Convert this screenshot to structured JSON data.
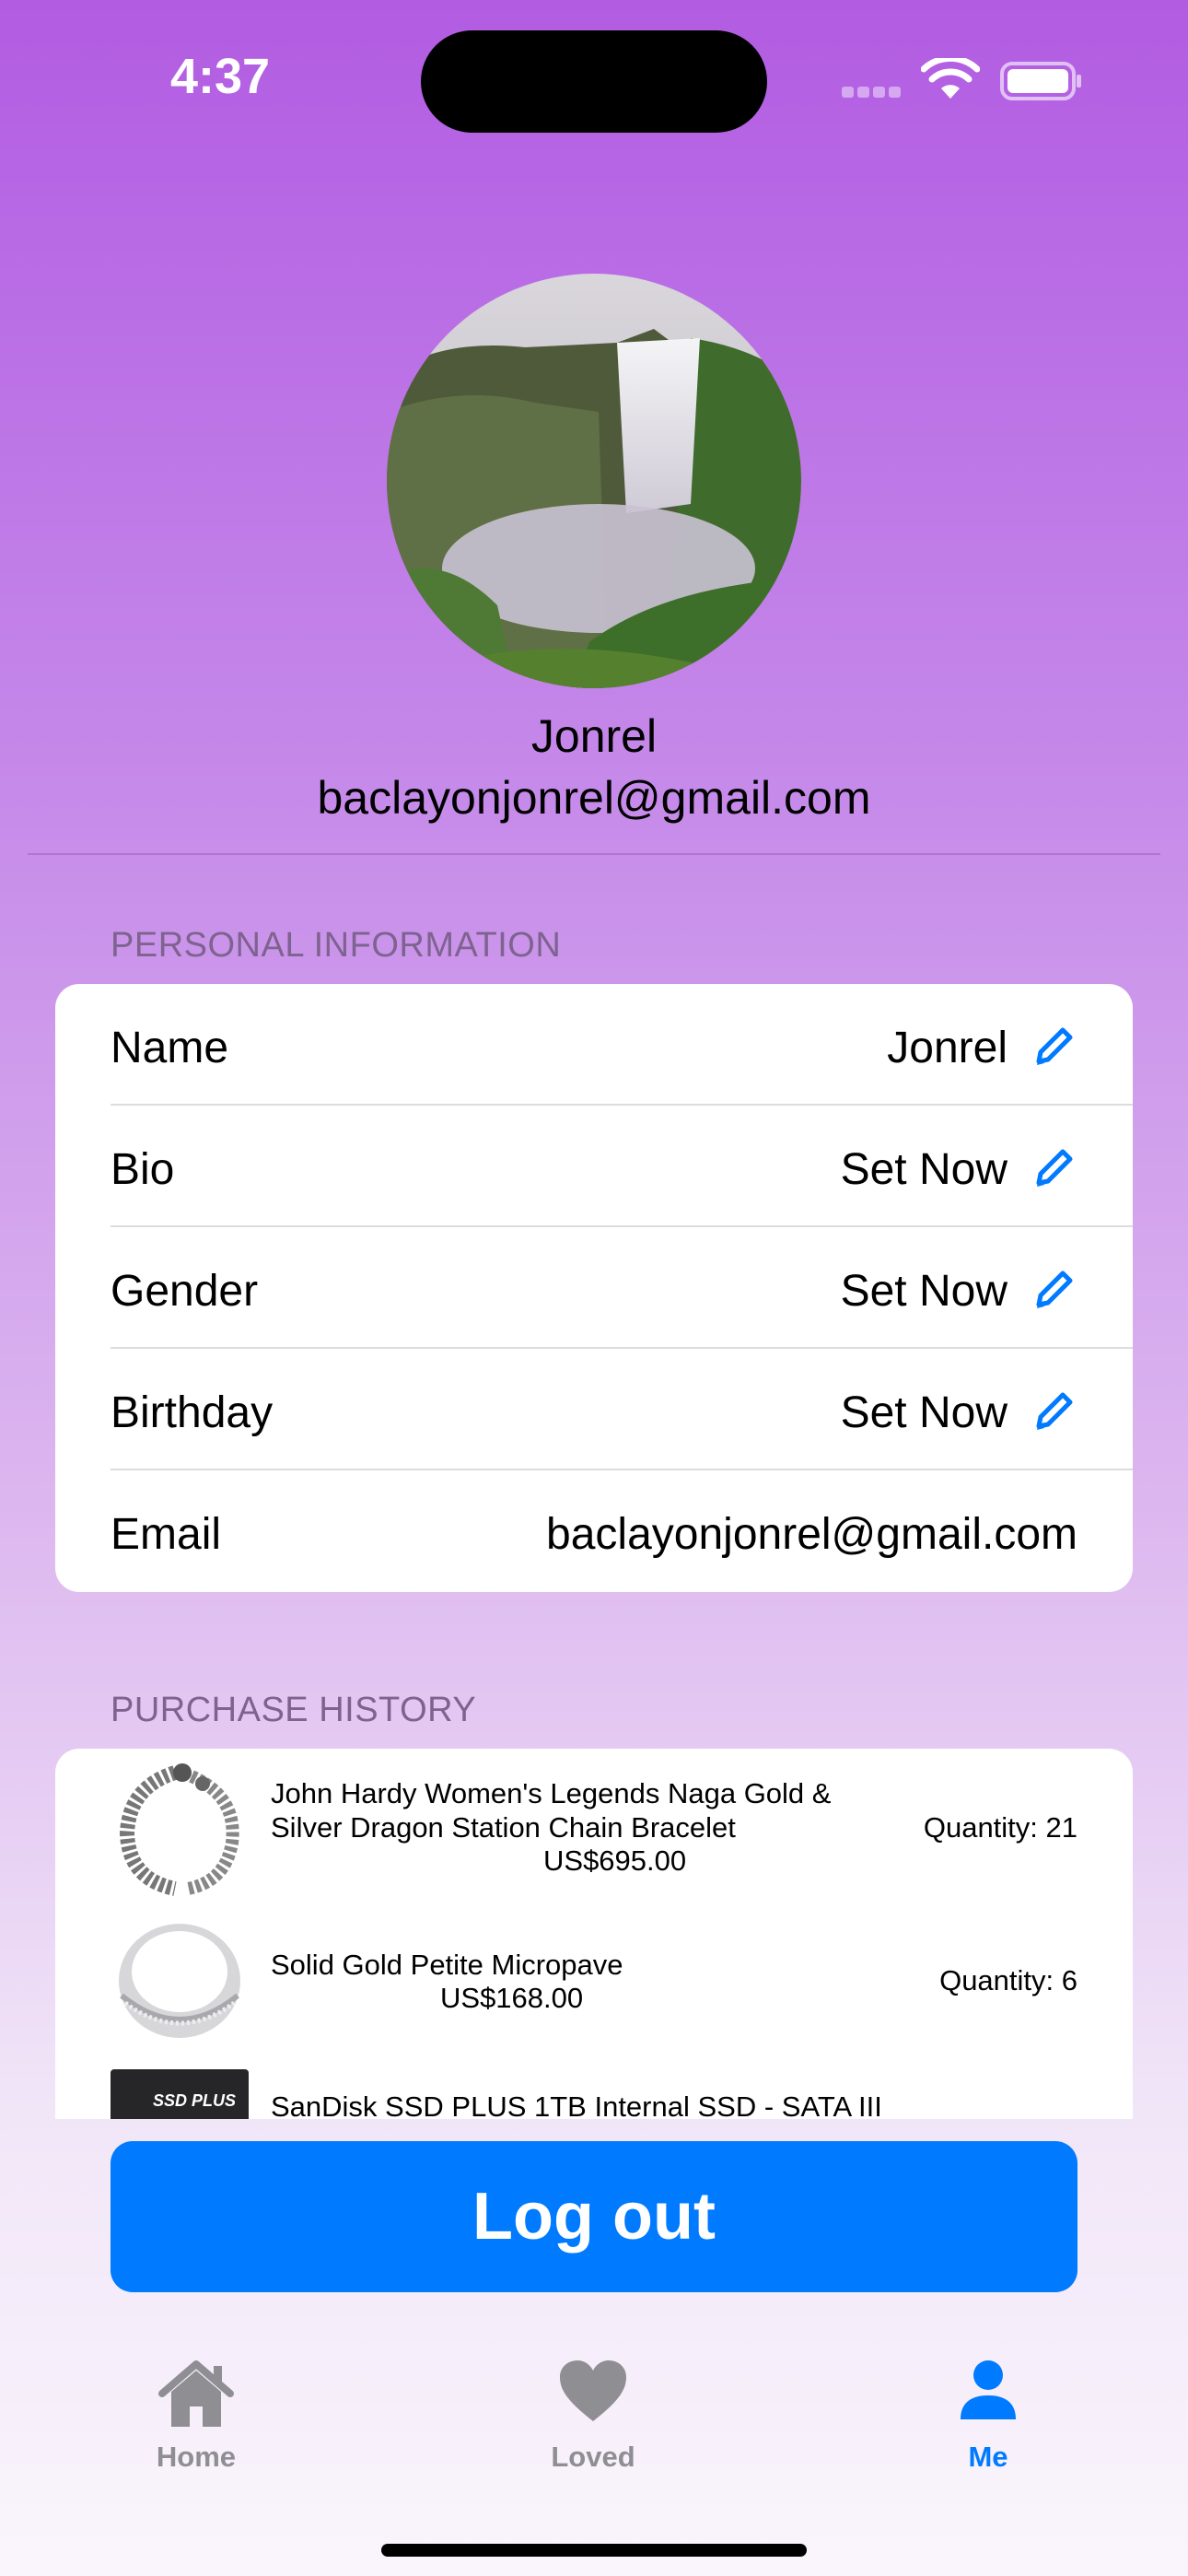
{
  "status_bar": {
    "time": "4:37"
  },
  "profile": {
    "name": "Jonrel",
    "email": "baclayonjonrel@gmail.com",
    "avatar": "waterfall-photo"
  },
  "personal_info": {
    "header": "PERSONAL INFORMATION",
    "rows": [
      {
        "label": "Name",
        "value": "Jonrel",
        "editable": true
      },
      {
        "label": "Bio",
        "value": "Set Now",
        "editable": true
      },
      {
        "label": "Gender",
        "value": "Set Now",
        "editable": true
      },
      {
        "label": "Birthday",
        "value": "Set Now",
        "editable": true
      },
      {
        "label": "Email",
        "value": "baclayonjonrel@gmail.com",
        "editable": false
      }
    ]
  },
  "purchase_history": {
    "header": "PURCHASE HISTORY",
    "items": [
      {
        "title": "John Hardy Women's Legends Naga Gold & Silver Dragon Station Chain Bracelet",
        "price": "US$695.00",
        "quantity": "Quantity: 21",
        "thumb": "bracelet-image"
      },
      {
        "title": "Solid Gold Petite Micropave",
        "price": "US$168.00",
        "quantity": "Quantity: 6",
        "thumb": "ring-image"
      },
      {
        "title": "SanDisk SSD PLUS 1TB Internal SSD - SATA III",
        "thumb_text": "SSD PLUS",
        "thumb": "ssd-image"
      }
    ]
  },
  "logout_label": "Log out",
  "tabs": [
    {
      "label": "Home",
      "icon": "house-icon",
      "active": false
    },
    {
      "label": "Loved",
      "icon": "heart-icon",
      "active": false
    },
    {
      "label": "Me",
      "icon": "person-icon",
      "active": true
    }
  ],
  "colors": {
    "accent": "#007aff",
    "tab_inactive": "#8e8e93",
    "gradient_top": "#b25ce2"
  }
}
